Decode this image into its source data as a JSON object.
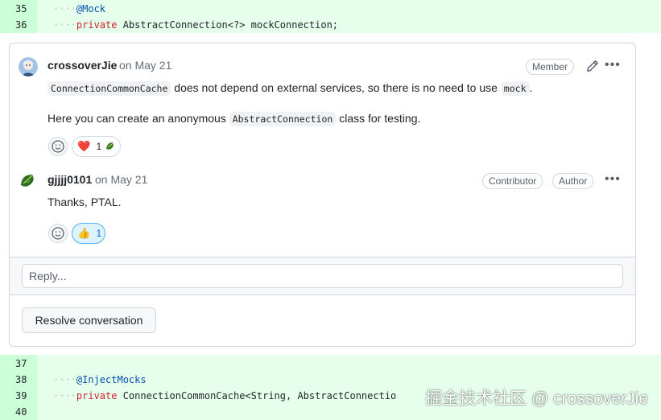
{
  "diff_top": [
    {
      "line": "35",
      "indent": "····",
      "tokens": [
        {
          "t": "@Mock",
          "c": "ann"
        }
      ]
    },
    {
      "line": "36",
      "indent": "····",
      "tokens": [
        {
          "t": "private",
          "c": "kw"
        },
        {
          "t": " AbstractConnection<?> mockConnection;",
          "c": ""
        }
      ]
    }
  ],
  "diff_bottom": [
    {
      "line": "37",
      "indent": "",
      "tokens": []
    },
    {
      "line": "38",
      "indent": "····",
      "tokens": [
        {
          "t": "@InjectMocks",
          "c": "ann"
        }
      ]
    },
    {
      "line": "39",
      "indent": "····",
      "tokens": [
        {
          "t": "private",
          "c": "kw"
        },
        {
          "t": " ConnectionCommonCache<String, AbstractConnectio",
          "c": ""
        }
      ]
    },
    {
      "line": "40",
      "indent": "",
      "tokens": []
    }
  ],
  "comments": {
    "first": {
      "author": "crossoverJie",
      "date": "on May 21",
      "badge": "Member",
      "body_line1": {
        "code1": "ConnectionCommonCache",
        "text1": " does not depend on external services, so there is no need to use ",
        "code2": "mock",
        "text2": "."
      },
      "body_line2": {
        "text1": "Here you can create an anonymous ",
        "code1": "AbstractConnection",
        "text2": " class for testing."
      },
      "reaction": {
        "emoji": "❤️",
        "count": "1"
      }
    },
    "second": {
      "author": "gjjjj0101",
      "date": "on May 21",
      "badges": [
        "Contributor",
        "Author"
      ],
      "body": "Thanks, PTAL.",
      "reaction": {
        "emoji": "👍",
        "count": "1"
      }
    }
  },
  "reply": {
    "placeholder": "Reply..."
  },
  "resolve_label": "Resolve conversation",
  "watermark": "掘金技术社区 @ crossoverJie",
  "colors": {
    "diff_bg": "#e6ffec",
    "gutter_bg": "#ccffd8",
    "keyword": "#cf222e",
    "annotation": "#0550ae"
  }
}
